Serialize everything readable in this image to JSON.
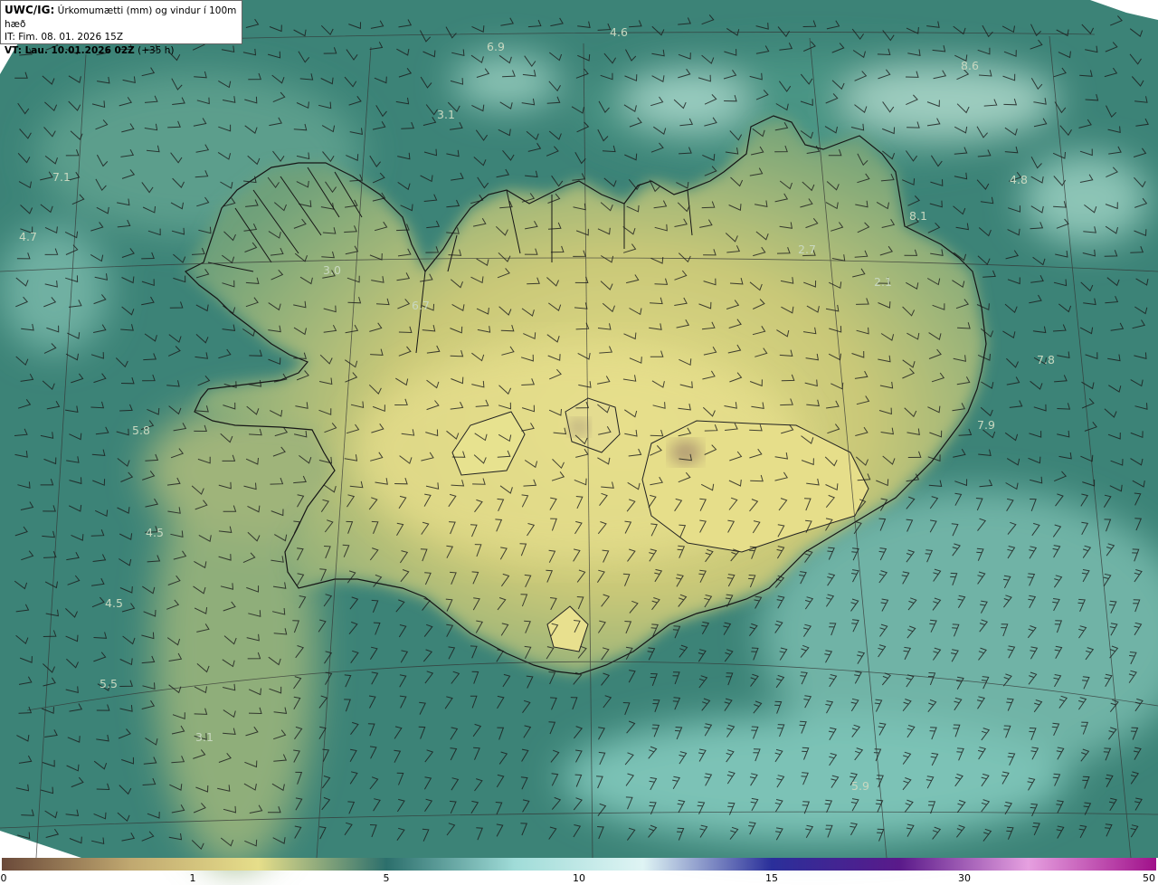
{
  "header": {
    "model_tag": "UWC/IG:",
    "product": "Úrkomumætti (mm) og vindur í 100m hæð",
    "init_time": "IT: Fim. 08. 01. 2026 15Z",
    "valid_prefix": "VT: Lau. 10.01.2026 02Z",
    "valid_lead": "(+35 h)"
  },
  "map_labels": [
    "6.9",
    "4.6",
    "3.1",
    "8.6",
    "7.1",
    "4.7",
    "3.0",
    "6.7",
    "4.8",
    "8.1",
    "2.7",
    "2.1",
    "7.8",
    "7.9",
    "5.8",
    "4.5",
    "4.5",
    "5.5",
    "3.1",
    "5.9"
  ],
  "colorbar": {
    "ticks": [
      "0",
      "1",
      "5",
      "10",
      "15",
      "30",
      "50"
    ],
    "colors": [
      "#6b4a3a",
      "#c0a870",
      "#e6de8a",
      "#2c6f6c",
      "#a0dcd8",
      "#dff4f4",
      "#2a2f9a",
      "#5a1a8a",
      "#e6a0e0",
      "#a0108a"
    ]
  },
  "colors": {
    "ocean": "#3d8479",
    "land_high": "#e0da88",
    "coast": "#1a1a1a",
    "grid": "#333333"
  }
}
